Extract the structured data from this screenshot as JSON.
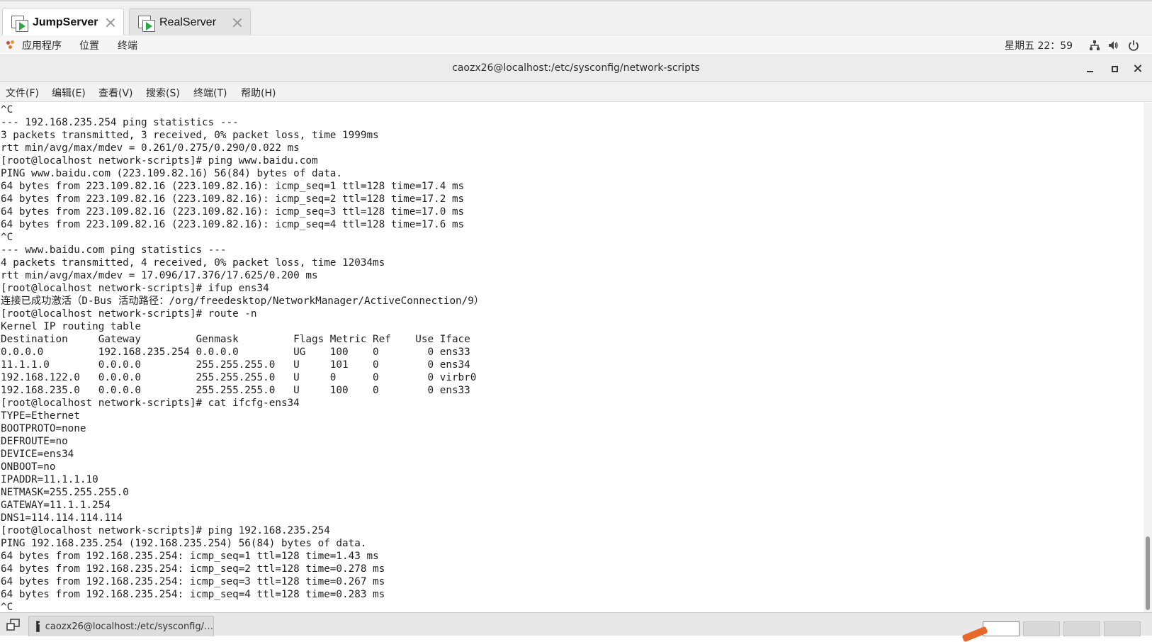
{
  "session_tabs": [
    {
      "label": "JumpServer",
      "active": true
    },
    {
      "label": "RealServer",
      "active": false
    }
  ],
  "topbar": {
    "applications": "应用程序",
    "places": "位置",
    "terminal": "终端",
    "clock": "星期五 22：59"
  },
  "window": {
    "title": "caozx26@localhost:/etc/sysconfig/network-scripts"
  },
  "menu": [
    "文件(F)",
    "编辑(E)",
    "查看(V)",
    "搜索(S)",
    "终端(T)",
    "帮助(H)"
  ],
  "terminal_lines": [
    "^C",
    "--- 192.168.235.254 ping statistics ---",
    "3 packets transmitted, 3 received, 0% packet loss, time 1999ms",
    "rtt min/avg/max/mdev = 0.261/0.275/0.290/0.022 ms",
    "[root@localhost network-scripts]# ping www.baidu.com",
    "PING www.baidu.com (223.109.82.16) 56(84) bytes of data.",
    "64 bytes from 223.109.82.16 (223.109.82.16): icmp_seq=1 ttl=128 time=17.4 ms",
    "64 bytes from 223.109.82.16 (223.109.82.16): icmp_seq=2 ttl=128 time=17.2 ms",
    "64 bytes from 223.109.82.16 (223.109.82.16): icmp_seq=3 ttl=128 time=17.0 ms",
    "64 bytes from 223.109.82.16 (223.109.82.16): icmp_seq=4 ttl=128 time=17.6 ms",
    "^C",
    "--- www.baidu.com ping statistics ---",
    "4 packets transmitted, 4 received, 0% packet loss, time 12034ms",
    "rtt min/avg/max/mdev = 17.096/17.376/17.625/0.200 ms",
    "[root@localhost network-scripts]# ifup ens34",
    "连接已成功激活（D-Bus 活动路径：/org/freedesktop/NetworkManager/ActiveConnection/9）",
    "[root@localhost network-scripts]# route -n",
    "Kernel IP routing table",
    "Destination     Gateway         Genmask         Flags Metric Ref    Use Iface",
    "0.0.0.0         192.168.235.254 0.0.0.0         UG    100    0        0 ens33",
    "11.1.1.0        0.0.0.0         255.255.255.0   U     101    0        0 ens34",
    "192.168.122.0   0.0.0.0         255.255.255.0   U     0      0        0 virbr0",
    "192.168.235.0   0.0.0.0         255.255.255.0   U     100    0        0 ens33",
    "[root@localhost network-scripts]# cat ifcfg-ens34",
    "TYPE=Ethernet",
    "BOOTPROTO=none",
    "DEFROUTE=no",
    "DEVICE=ens34",
    "ONBOOT=no",
    "IPADDR=11.1.1.10",
    "NETMASK=255.255.255.0",
    "GATEWAY=11.1.1.254",
    "DNS1=114.114.114.114",
    "[root@localhost network-scripts]# ping 192.168.235.254",
    "PING 192.168.235.254 (192.168.235.254) 56(84) bytes of data.",
    "64 bytes from 192.168.235.254: icmp_seq=1 ttl=128 time=1.43 ms",
    "64 bytes from 192.168.235.254: icmp_seq=2 ttl=128 time=0.278 ms",
    "64 bytes from 192.168.235.254: icmp_seq=3 ttl=128 time=0.267 ms",
    "64 bytes from 192.168.235.254: icmp_seq=4 ttl=128 time=0.283 ms",
    "^C"
  ],
  "taskbar": {
    "window_label": "caozx26@localhost:/etc/sysconfig/…",
    "workspaces": 4,
    "active_workspace": 1
  },
  "icons": {
    "tab_icon": "remote-session-icon",
    "apps": "gnome-foot-icon",
    "network": "network-wired-icon",
    "volume": "speaker-icon",
    "power": "power-icon"
  },
  "colors": {
    "play_green": "#2ea843",
    "terminal_bg": "#ffffff",
    "terminal_fg": "#1f1f1f"
  }
}
